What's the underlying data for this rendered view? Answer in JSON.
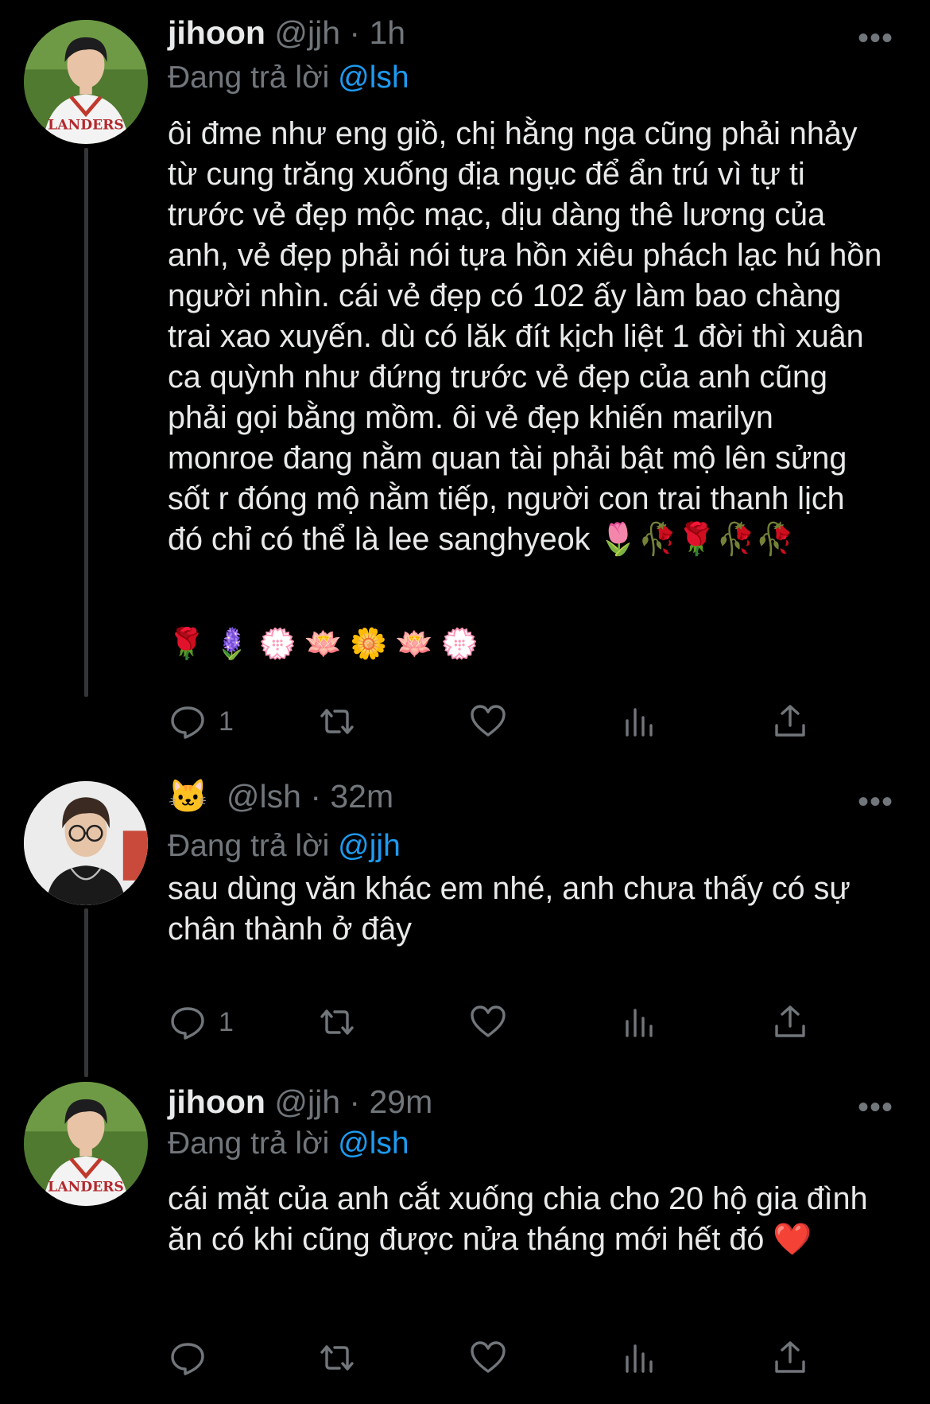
{
  "tweets": [
    {
      "name": "jihoon",
      "handle": "@jjh",
      "dot": "·",
      "time": "1h",
      "more": "•••",
      "reply_prefix": "Đang trả lời ",
      "reply_mention": "@lsh",
      "body_text": "ôi đme như eng giồ, chị hằng nga cũng phải nhảy từ cung trăng xuống địa ngục để ẩn trú vì tự ti trước vẻ đẹp mộc mạc, dịu dàng thê lương của anh, vẻ đẹp phải nói tựa hồn xiêu phách lạc hú hồn người nhìn. cái vẻ đẹp có 102 ấy làm bao chàng trai xao xuyến. dù có lăk đít kịch liệt 1 đời thì xuân ca quỳnh như đứng trước vẻ đẹp của anh cũng phải gọi bằng mồm. ôi vẻ đẹp khiến marilyn monroe đang nằm quan tài phải bật mộ lên sửng sốt r đóng mộ nằm tiếp, người con trai thanh lịch đó chỉ có thể là lee sanghyeok 🌷🥀🌹🥀🥀",
      "emoji_line": "🌹🪻💮🪷🌼🪷💮",
      "reply_count": "1",
      "avatar": "jihoon-avatar"
    },
    {
      "name_emoji": "🐱",
      "handle": "@lsh",
      "dot": "·",
      "time": "32m",
      "more": "•••",
      "reply_prefix": "Đang trả lời ",
      "reply_mention": "@jjh",
      "body_text": "sau dùng văn khác em nhé, anh chưa thấy có sự chân thành ở đây",
      "reply_count": "1",
      "avatar": "lsh-avatar"
    },
    {
      "name": "jihoon",
      "handle": "@jjh",
      "dot": "·",
      "time": "29m",
      "more": "•••",
      "reply_prefix": "Đang trả lời ",
      "reply_mention": "@lsh",
      "body_text": "cái mặt của anh cắt xuống chia cho 20 hộ gia đình ăn có khi cũng được nửa tháng mới hết đó ❤️",
      "reply_count": "",
      "avatar": "jihoon-avatar"
    }
  ],
  "icons": {
    "reply": "reply-icon",
    "retweet": "retweet-icon",
    "like": "like-icon",
    "views": "views-icon",
    "share": "share-icon"
  },
  "colors": {
    "background": "#000000",
    "text": "#e7e9ea",
    "secondary": "#71767b",
    "mention": "#1d9bf0",
    "thread_line": "#333639"
  }
}
